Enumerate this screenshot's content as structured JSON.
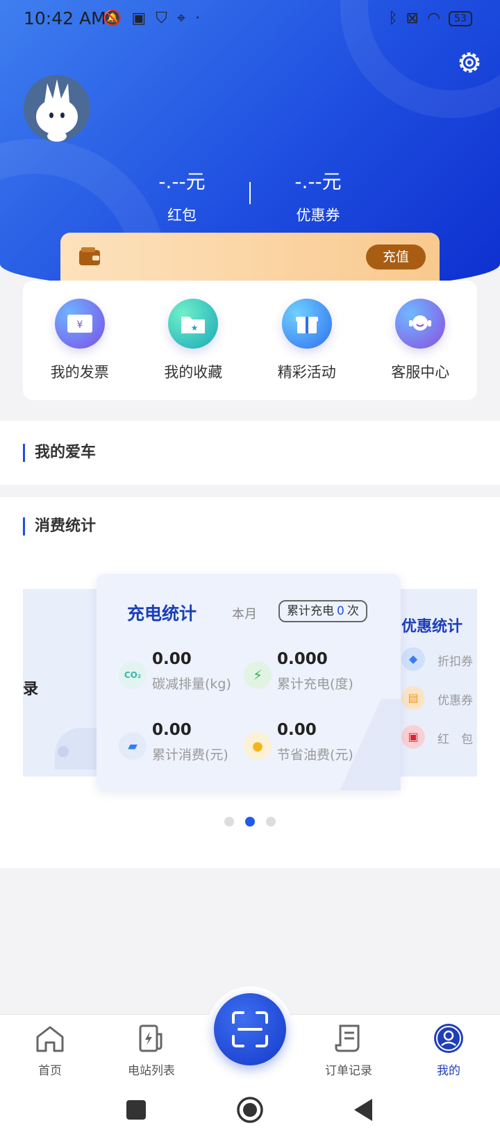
{
  "status_bar": {
    "time": "10:42 AM",
    "battery": "53"
  },
  "balances": [
    {
      "value": "-.--元",
      "label": "红包"
    },
    {
      "value": "-.--元",
      "label": "优惠券"
    }
  ],
  "recharge": {
    "button_label": "充值"
  },
  "quick_actions": [
    {
      "label": "我的发票",
      "icon": "invoice-icon"
    },
    {
      "label": "我的收藏",
      "icon": "favorites-folder-icon"
    },
    {
      "label": "精彩活动",
      "icon": "gift-icon"
    },
    {
      "label": "客服中心",
      "icon": "customer-service-icon"
    }
  ],
  "sections": {
    "my_car": "我的爱车",
    "consumption": "消费统计"
  },
  "carousel": {
    "left_card": {
      "partial_text": "录"
    },
    "main_card": {
      "title": "充电统计",
      "period": "本月",
      "badge_prefix": "累计充电",
      "badge_count": "0",
      "badge_suffix": "次",
      "stats": [
        {
          "value": "0.00",
          "label": "碳减排量(kg)",
          "icon": "co2-icon"
        },
        {
          "value": "0.000",
          "label": "累计充电(度)",
          "icon": "lightning-icon"
        },
        {
          "value": "0.00",
          "label": "累计消费(元)",
          "icon": "wallet-icon"
        },
        {
          "value": "0.00",
          "label": "节省油费(元)",
          "icon": "oil-drop-icon"
        }
      ]
    },
    "right_card": {
      "title": "优惠统计",
      "items": [
        "折扣券",
        "优惠券",
        "红　包"
      ]
    },
    "active_page": 2,
    "page_count": 3
  },
  "tabbar": [
    {
      "label": "首页",
      "icon": "home-icon"
    },
    {
      "label": "电站列表",
      "icon": "charging-station-icon"
    },
    {
      "label": "订单记录",
      "icon": "order-record-icon"
    },
    {
      "label": "我的",
      "icon": "profile-icon"
    }
  ]
}
